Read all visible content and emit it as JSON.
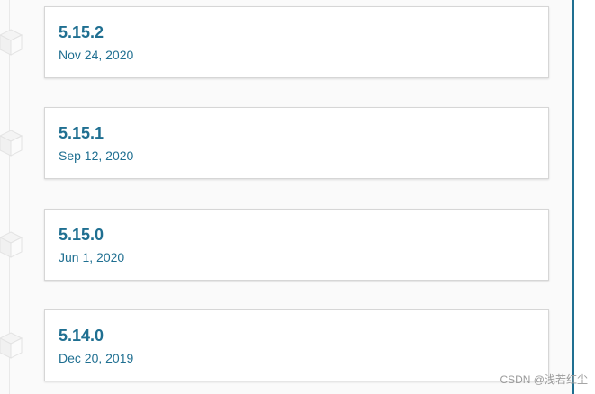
{
  "colors": {
    "accent": "#1f6f91",
    "card_border": "#d6d6d6",
    "background": "#fafafa"
  },
  "releases": [
    {
      "version": "5.15.2",
      "date": "Nov 24, 2020",
      "icon": "package-cube-icon"
    },
    {
      "version": "5.15.1",
      "date": "Sep 12, 2020",
      "icon": "package-cube-icon"
    },
    {
      "version": "5.15.0",
      "date": "Jun 1, 2020",
      "icon": "package-cube-icon"
    },
    {
      "version": "5.14.0",
      "date": "Dec 20, 2019",
      "icon": "package-cube-icon"
    }
  ],
  "watermark": "CSDN @浅若红尘"
}
